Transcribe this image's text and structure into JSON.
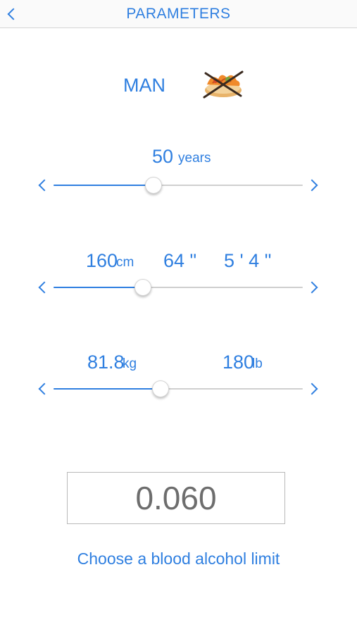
{
  "nav": {
    "back_icon": "chevron-left-icon",
    "title": "PARAMETERS"
  },
  "gender": {
    "label": "MAN",
    "icon": "crossed-out-food-icon"
  },
  "age": {
    "value": "50",
    "unit": "years",
    "level": 0.4
  },
  "height": {
    "cm_value": "160",
    "cm_unit": "cm",
    "inches": "64 \"",
    "feet_inches": "5 ' 4 \"",
    "level": 0.36
  },
  "weight": {
    "kg_value": "81.8",
    "kg_unit": "kg",
    "lb_value": "180",
    "lb_unit": "lb",
    "level": 0.43
  },
  "limit": {
    "value": "0.060",
    "caption": "Choose a blood alcohol limit"
  },
  "colors": {
    "accent": "#2f7fe0",
    "track": "#cfcfcf",
    "limit_text": "#6d6d6d"
  }
}
